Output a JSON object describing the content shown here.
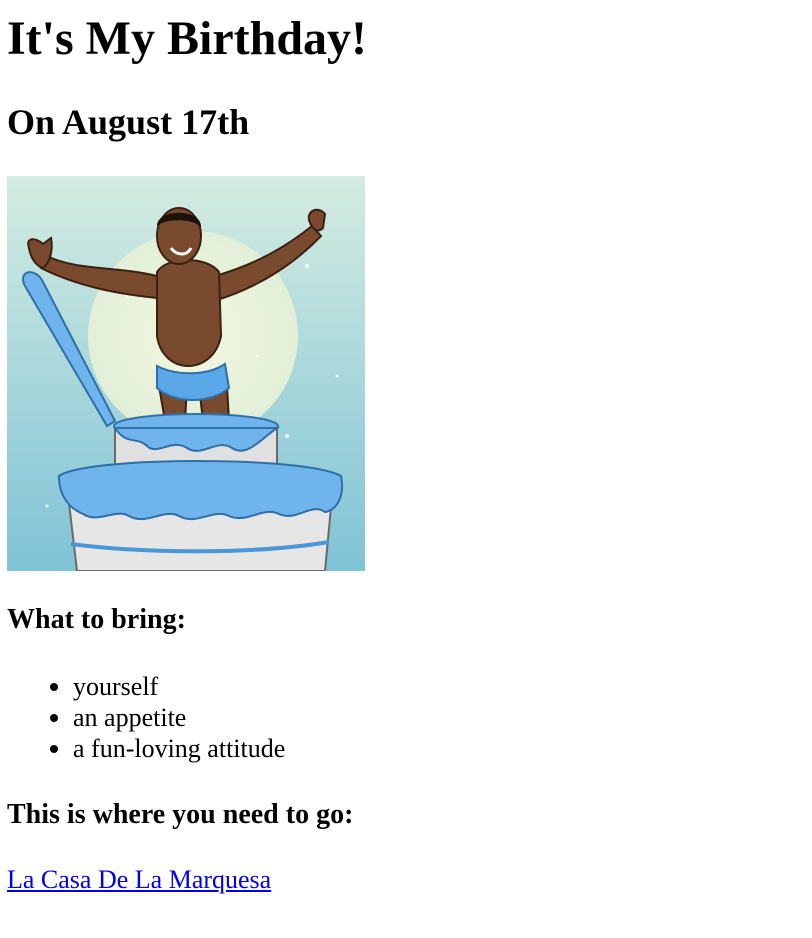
{
  "header": {
    "title": "It's My Birthday!",
    "date": "On August 17th"
  },
  "image": {
    "alt": "Man popping out of a blue frosted cake"
  },
  "bring": {
    "heading": "What to bring:",
    "items": [
      "yourself",
      "an appetite",
      "a fun-loving attitude"
    ]
  },
  "location": {
    "heading": "This is where you need to go:",
    "link_text": "La Casa De La Marquesa"
  },
  "colors": {
    "link": "#0000ee",
    "frosting": "#5aa8e8",
    "background_tint": "#a9d8de"
  }
}
